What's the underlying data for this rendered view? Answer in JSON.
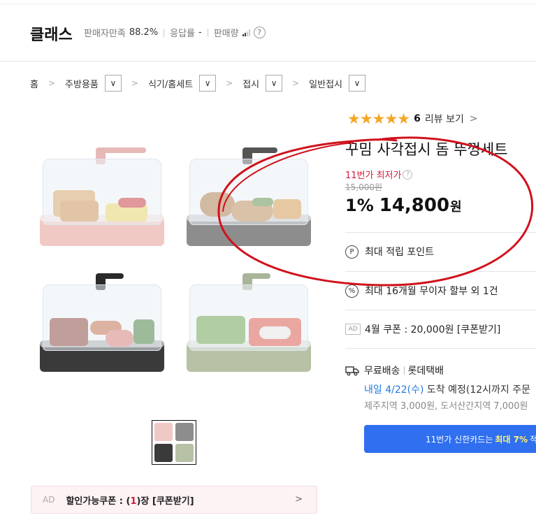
{
  "store": {
    "name": "클래스",
    "satisfaction_label": "판매자만족",
    "satisfaction_value": "88.2%",
    "response_label": "응답률",
    "response_value": "-",
    "sales_label": "판매량",
    "help": "?"
  },
  "breadcrumb": {
    "items": [
      "홈",
      "주방용품",
      "식기/홈세트",
      "접시",
      "일반접시"
    ],
    "separator": ">",
    "dropdown": "∨"
  },
  "product": {
    "rating_stars": "★★★★★",
    "rating": 4.5,
    "review_count": "6",
    "review_link": "리뷰 보기",
    "title": "꾸밈 사각접시 돔 뚜껑세트",
    "lowest_label": "11번가 최저가",
    "original_price": "15,000원",
    "discount_rate": "1%",
    "price": "14,800",
    "currency": "원"
  },
  "benefits": {
    "point_icon": "P",
    "point_text": "최대 적립 포인트",
    "installment_icon": "%",
    "installment_text": "최대 16개월 무이자 할부 외 1건",
    "ad_label": "AD",
    "coupon_text": "4월 쿠폰 : 20,000원 [쿠폰받기]"
  },
  "shipping": {
    "free": "무료배송",
    "carrier": "롯데택배",
    "date_highlight": "내일 4/22(수)",
    "date_rest": " 도착 예정(12시까지 주문",
    "extra_fee": "제주지역 3,000원, 도서산간지역 7,000원"
  },
  "card_banner": {
    "prefix": "11번가 신한카드는",
    "highlight": "최대 7%",
    "suffix": "적"
  },
  "coupon_bar": {
    "ad": "AD",
    "prefix": "할인가능쿠폰 : (",
    "count": "1",
    "suffix": ")장 [쿠폰받기]"
  },
  "colors": {
    "accent_red": "#d6193d",
    "link_blue": "#1f7ae0",
    "banner_blue": "#2f6ff0",
    "star": "#f5a623",
    "annotation": "#d0121c"
  }
}
